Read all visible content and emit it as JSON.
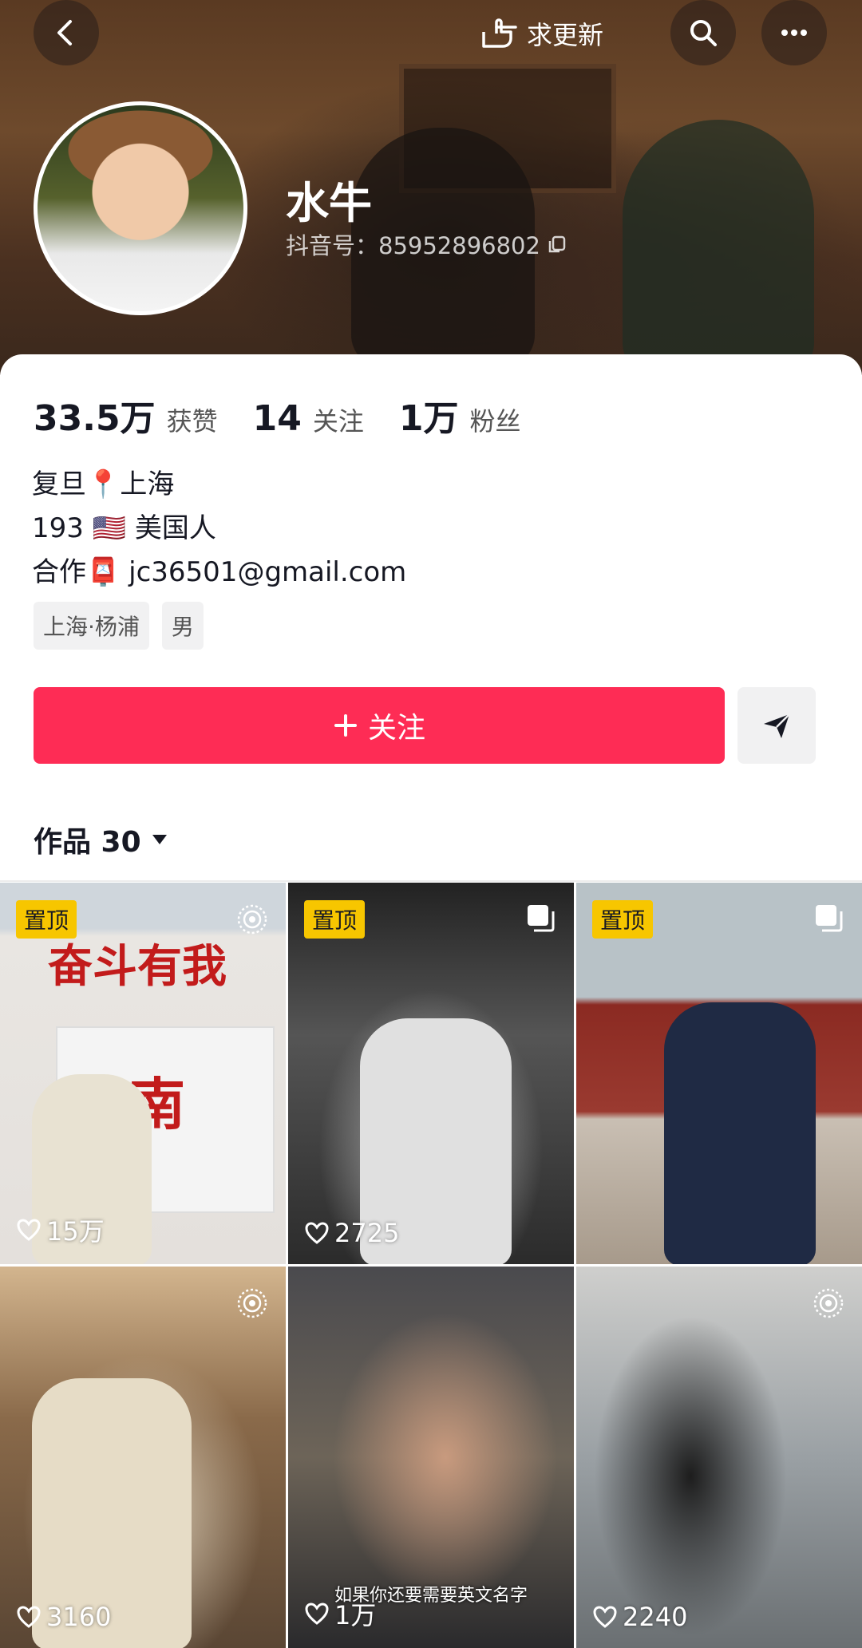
{
  "header": {
    "update_label": "求更新",
    "name": "水牛",
    "douyin_id": "抖音号：85952896802"
  },
  "stats": [
    {
      "value": "33.5万",
      "label": "获赞"
    },
    {
      "value": "14",
      "label": "关注"
    },
    {
      "value": "1万",
      "label": "粉丝"
    }
  ],
  "bio": {
    "line1": "复旦📍上海",
    "line2": "193 🇺🇸 美国人",
    "line3": "合作📮 jc36501@gmail.com"
  },
  "tags": [
    "上海·杨浦",
    "男"
  ],
  "follow_label": "关注",
  "works": {
    "label": "作品 30"
  },
  "videos": [
    {
      "pinned": "置顶",
      "likes": "15万",
      "badge": "live-icon"
    },
    {
      "pinned": "置顶",
      "likes": "2725",
      "badge": "multi-photo-icon"
    },
    {
      "pinned": "置顶",
      "likes": "",
      "badge": "multi-photo-icon"
    },
    {
      "pinned": "",
      "likes": "3160",
      "badge": "live-icon"
    },
    {
      "pinned": "",
      "likes": "1万",
      "badge": "",
      "caption": "如果你还要需要英文名字"
    },
    {
      "pinned": "",
      "likes": "2240",
      "badge": "live-icon"
    }
  ],
  "grid_extra": {
    "c1_poster": "奋斗有我",
    "c1_board": "济南"
  },
  "colors": {
    "accent": "#fe2c55",
    "pin": "#f7c600"
  }
}
